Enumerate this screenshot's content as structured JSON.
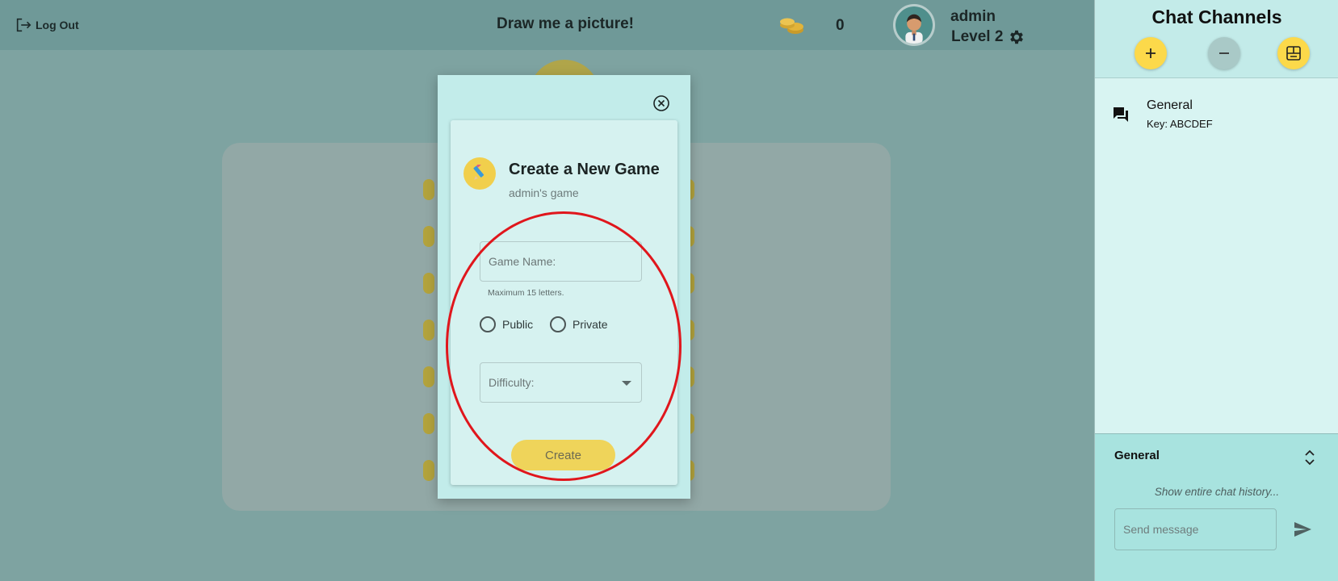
{
  "header": {
    "logout_label": "Log Out",
    "title": "Draw me a picture!",
    "coins": "0",
    "username": "admin",
    "level": "Level 2"
  },
  "modal": {
    "title": "Create a New Game",
    "subtitle": "admin's game",
    "game_name_placeholder": "Game Name:",
    "game_name_value": "",
    "game_name_hint": "Maximum 15 letters.",
    "visibility_options": [
      "Public",
      "Private"
    ],
    "difficulty_placeholder": "Difficulty:",
    "create_label": "Create"
  },
  "sidebar": {
    "title": "Chat Channels",
    "channels": [
      {
        "name": "General",
        "key": "Key: ABCDEF"
      }
    ]
  },
  "chat": {
    "channel_name": "General",
    "history_link": "Show entire chat history...",
    "message_placeholder": "Send message"
  },
  "colors": {
    "accent_yellow": "#fcd94a",
    "modal_bg": "#c2ecea",
    "annotation_red": "#e0161c"
  },
  "icons": {
    "logout": "logout-icon",
    "coins": "coins-icon",
    "settings": "gear-icon",
    "close": "close-circle-icon",
    "pencil": "pencil-icon",
    "add_channel": "plus-icon",
    "remove_channel": "minus-icon",
    "join_channel": "window-icon",
    "channel": "chat-bubbles-icon",
    "toggle": "expand-collapse-icon",
    "send": "send-icon"
  }
}
